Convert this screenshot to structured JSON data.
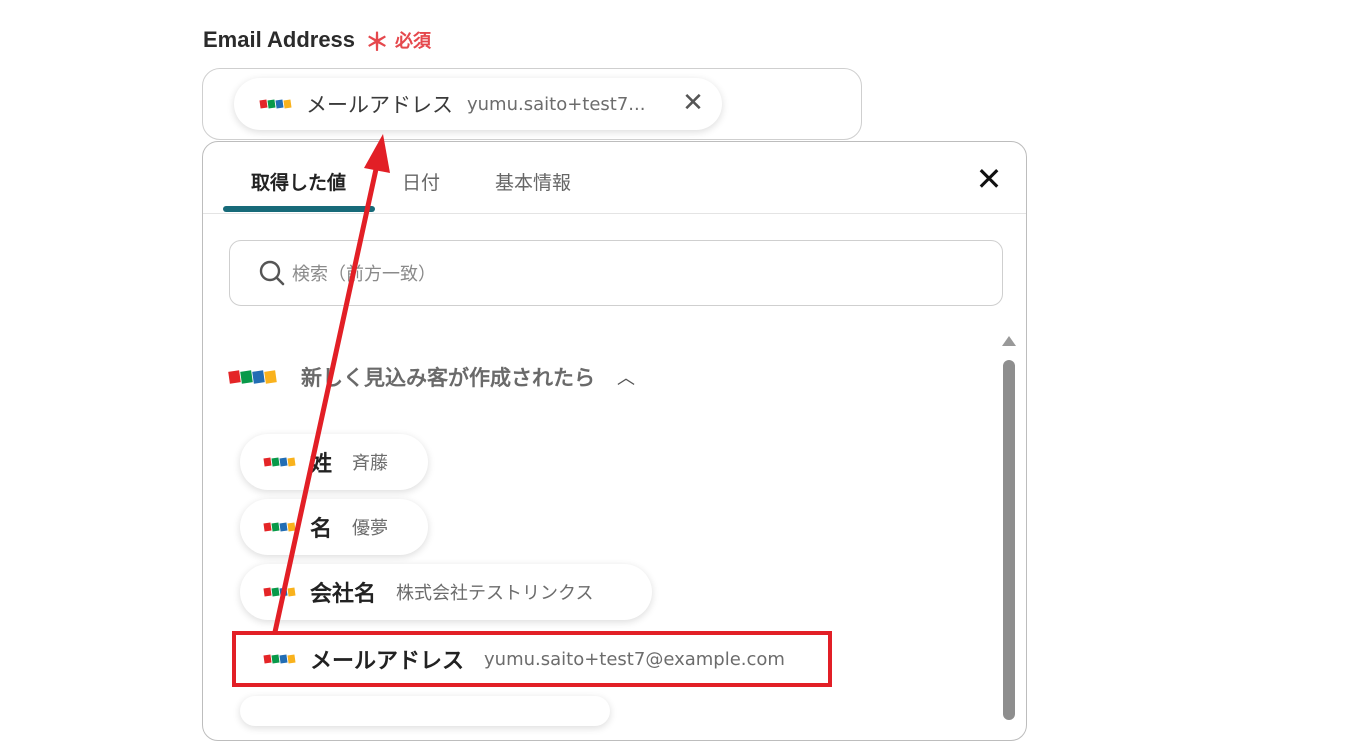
{
  "field": {
    "label": "Email Address",
    "required_mark": "＊",
    "required_text": "必須",
    "selected_chip": {
      "name": "メールアドレス",
      "value": "yumu.saito+test7..."
    },
    "remove_icon": "close-icon"
  },
  "panel": {
    "tabs": [
      {
        "label": "取得した値",
        "active": true
      },
      {
        "label": "日付",
        "active": false
      },
      {
        "label": "基本情報",
        "active": false
      }
    ],
    "close_icon": "close-icon",
    "search": {
      "placeholder": "検索（前方一致）",
      "icon": "search-icon"
    },
    "group": {
      "title": "新しく見込み客が作成されたら",
      "expanded": true,
      "logo": "zoho-logo",
      "items": [
        {
          "name": "姓",
          "value": "斉藤"
        },
        {
          "name": "名",
          "value": "優夢"
        },
        {
          "name": "会社名",
          "value": "株式会社テストリンクス"
        },
        {
          "name": "メールアドレス",
          "value": "yumu.saito+test7@example.com"
        }
      ]
    }
  },
  "annotation": {
    "color": "#e21f26"
  },
  "colors": {
    "accent": "#176a79",
    "required": "#e5484d"
  }
}
